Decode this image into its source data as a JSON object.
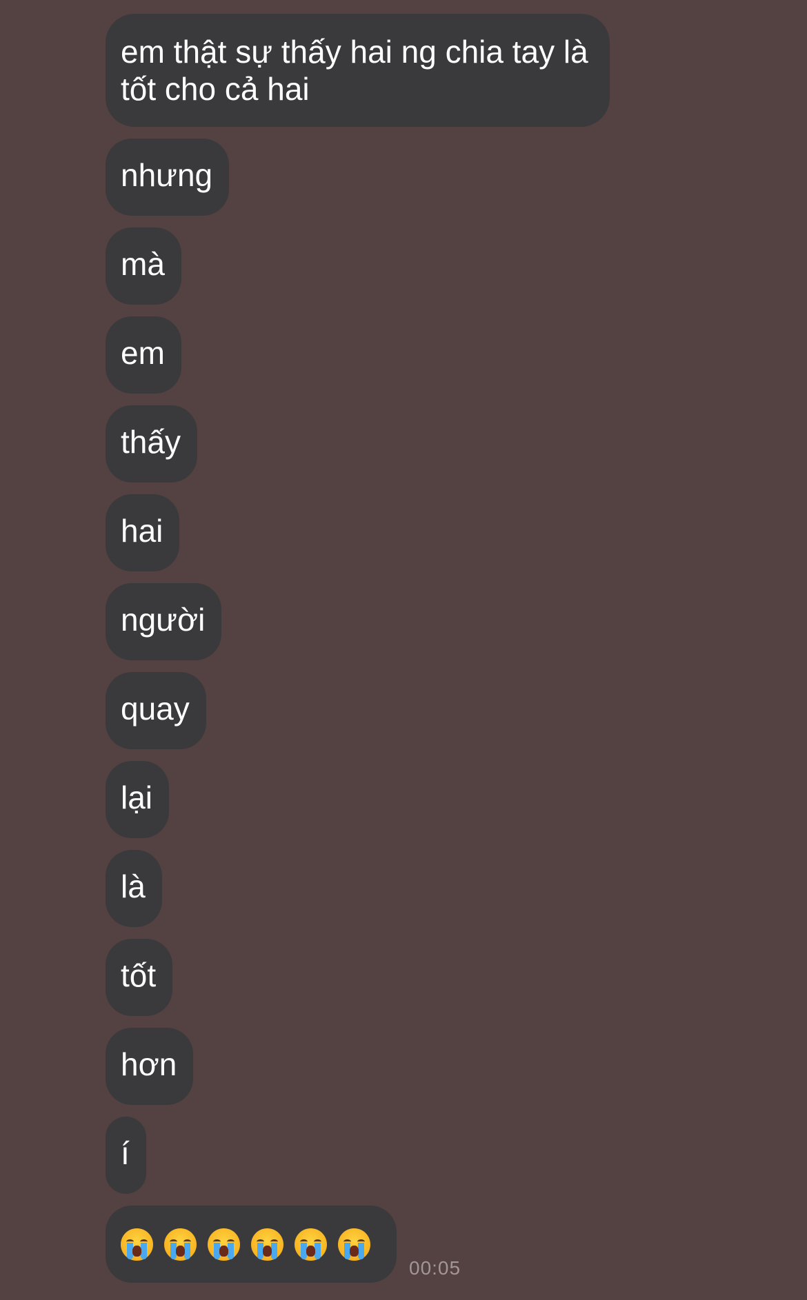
{
  "messages": [
    "em thật sự thấy hai ng chia tay là tốt cho cả hai",
    "nhưng",
    "mà",
    "em",
    "thấy",
    "hai",
    "người",
    "quay",
    "lại",
    "là",
    "tốt",
    "hơn",
    "í"
  ],
  "last_message": {
    "emoji_icon": "loudly-crying-face-icon",
    "emoji_count": 6,
    "time": "00:05"
  },
  "colors": {
    "background": "#544142",
    "bubble": "#3a3a3c",
    "text": "#ffffff",
    "time": "#a39696"
  }
}
